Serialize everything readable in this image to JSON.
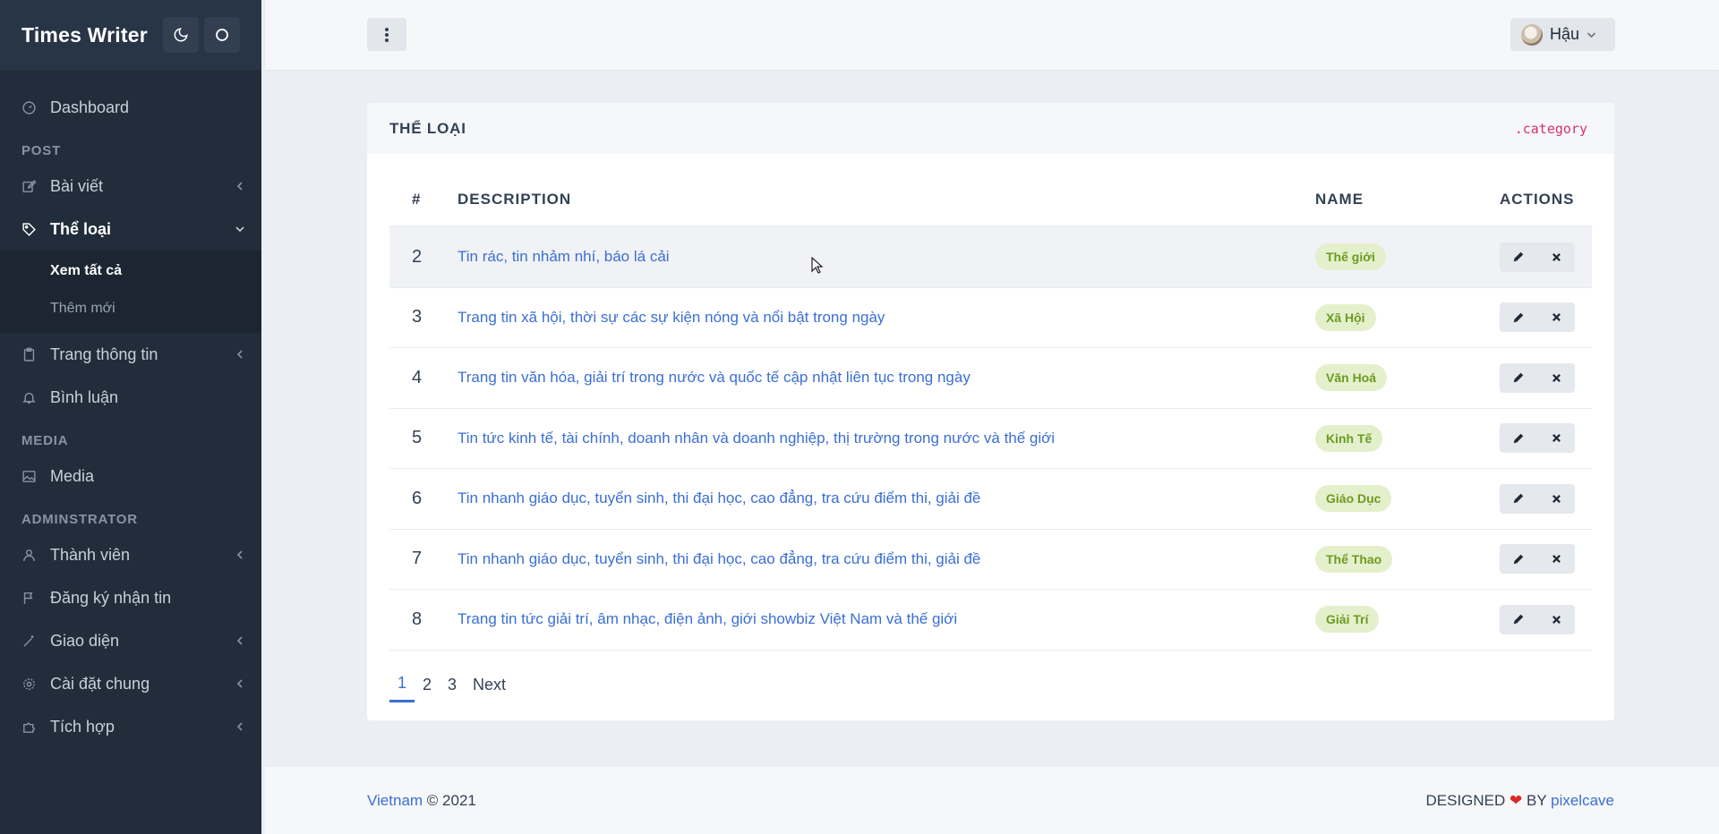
{
  "brand": "Times Writer",
  "sidebar": {
    "items": [
      {
        "label": "Dashboard"
      },
      {
        "heading": "POST"
      },
      {
        "label": "Bài viết"
      },
      {
        "label": "Thể loại"
      },
      {
        "sub": [
          "Xem tất cả",
          "Thêm mới"
        ]
      },
      {
        "label": "Trang thông tin"
      },
      {
        "label": "Bình luận"
      },
      {
        "heading": "MEDIA"
      },
      {
        "label": "Media"
      },
      {
        "heading": "ADMINSTRATOR"
      },
      {
        "label": "Thành viên"
      },
      {
        "label": "Đăng ký nhận tin"
      },
      {
        "label": "Giao diện"
      },
      {
        "label": "Cài đặt chung"
      },
      {
        "label": "Tích hợp"
      }
    ]
  },
  "header": {
    "user_name": "Hậu"
  },
  "card": {
    "title": "THỂ LOẠI",
    "code": ".category",
    "columns": [
      "#",
      "DESCRIPTION",
      "NAME",
      "ACTIONS"
    ],
    "rows": [
      {
        "num": "2",
        "description": "Tin rác, tin nhảm nhí, báo lá cải",
        "name": "Thế giới"
      },
      {
        "num": "3",
        "description": "Trang tin xã hội, thời sự các sự kiện nóng và nổi bật trong ngày",
        "name": "Xã Hội"
      },
      {
        "num": "4",
        "description": "Trang tin văn hóa, giải trí trong nước và quốc tế cập nhật liên tục trong ngày",
        "name": "Văn Hoá"
      },
      {
        "num": "5",
        "description": "Tin tức kinh tế, tài chính, doanh nhân và doanh nghiệp, thị trường trong nước và thế giới",
        "name": "Kinh Tế"
      },
      {
        "num": "6",
        "description": "Tin nhanh giáo dục, tuyển sinh, thi đại học, cao đẳng, tra cứu điểm thi, giải đề",
        "name": "Giáo Dục"
      },
      {
        "num": "7",
        "description": "Tin nhanh giáo dục, tuyển sinh, thi đại học, cao đẳng, tra cứu điểm thi, giải đề",
        "name": "Thể Thao"
      },
      {
        "num": "8",
        "description": "Trang tin tức giải trí, âm nhạc, điện ảnh, giới showbiz Việt Nam và thế giới",
        "name": "Giải Trí"
      }
    ],
    "pagination": [
      "1",
      "2",
      "3",
      "Next"
    ]
  },
  "footer": {
    "left_link": "Vietnam",
    "left_text": "© 2021",
    "right_prefix": "DESIGNED",
    "heart": "❤",
    "right_by": "BY",
    "right_link": "pixelcave"
  }
}
